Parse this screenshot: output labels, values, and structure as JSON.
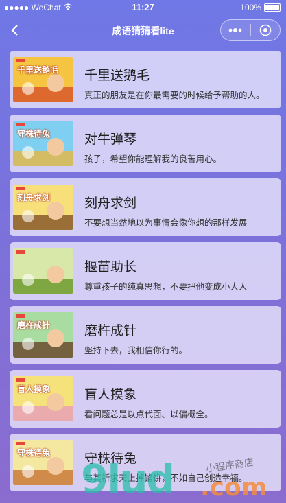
{
  "status_bar": {
    "carrier": "●●●●● WeChat",
    "time": "11:27",
    "battery": "100%"
  },
  "nav": {
    "title": "成语猜猜看lite",
    "more_icon": "more-dots-icon",
    "close_icon": "target-circle-icon"
  },
  "items": [
    {
      "title": "千里送鹅毛",
      "desc": "真正的朋友是在你最需要的时候给予帮助的人。",
      "thumb_text": "千里送鹅毛",
      "colors": [
        "#f5c542",
        "#d9582b"
      ]
    },
    {
      "title": "对牛弹琴",
      "desc": "孩子，希望你能理解我的良苦用心。",
      "thumb_text": "守株待兔",
      "colors": [
        "#7fd0f0",
        "#e2b84a"
      ]
    },
    {
      "title": "刻舟求剑",
      "desc": "不要想当然地以为事情会像你想的那样发展。",
      "thumb_text": "刻舟求剑",
      "colors": [
        "#f7df7a",
        "#8a5a2c"
      ]
    },
    {
      "title": "揠苗助长",
      "desc": "尊重孩子的纯真思想，不要把他变成小大人。",
      "thumb_text": "",
      "colors": [
        "#d8e8a8",
        "#6f9a2f"
      ]
    },
    {
      "title": "磨杵成针",
      "desc": "坚持下去，我相信你行的。",
      "thumb_text": "磨杵成针",
      "colors": [
        "#a9dca0",
        "#6a4b2f"
      ]
    },
    {
      "title": "盲人摸象",
      "desc": "看问题总是以点代面、以偏概全。",
      "thumb_text": "盲人摸象",
      "colors": [
        "#f6e27a",
        "#e7a1b8"
      ]
    },
    {
      "title": "守株待兔",
      "desc": "与其祈求天上掉馅饼，不如自己创造幸福。",
      "thumb_text": "守株待兔",
      "colors": [
        "#f4e8a0",
        "#c9793a"
      ]
    }
  ],
  "watermark": {
    "main": "9lud",
    "suffix": ".com",
    "cn": "小程序商店"
  }
}
